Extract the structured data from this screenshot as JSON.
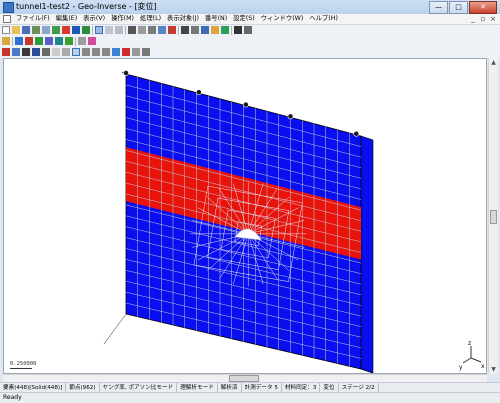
{
  "window": {
    "title": "tunnel1-test2 - Geo-Inverse - [変位]",
    "minimize": "—",
    "maximize": "□",
    "close": "✕"
  },
  "menubar": {
    "items": [
      "ファイル(F)",
      "編集(E)",
      "表示(V)",
      "操作(M)",
      "処理(L)",
      "表示対象(J)",
      "番号(N)",
      "設定(S)",
      "ウィンドウ(W)",
      "ヘルプ(H)"
    ],
    "doc_controls": [
      "_",
      "▫",
      "×"
    ]
  },
  "viewport": {
    "scale_value": "0.250000",
    "axes": {
      "x": "x",
      "y": "y",
      "z": "z"
    }
  },
  "statusbar": {
    "fields": [
      "要素(448)[Solid(448)]",
      "節点(962)",
      "ヤング率, ポアソン比モード",
      "理解析モード",
      "解析済",
      "計測データ 5",
      "材料同定：3",
      "変位",
      "ステージ 2/2"
    ]
  },
  "readybar": {
    "text": "Ready"
  },
  "colors": {
    "mesh_blue": "#0a0ff0",
    "mesh_red": "#e8140c",
    "mesh_grid": "#c8ccd6",
    "title_bar": "#c3d7f0"
  }
}
